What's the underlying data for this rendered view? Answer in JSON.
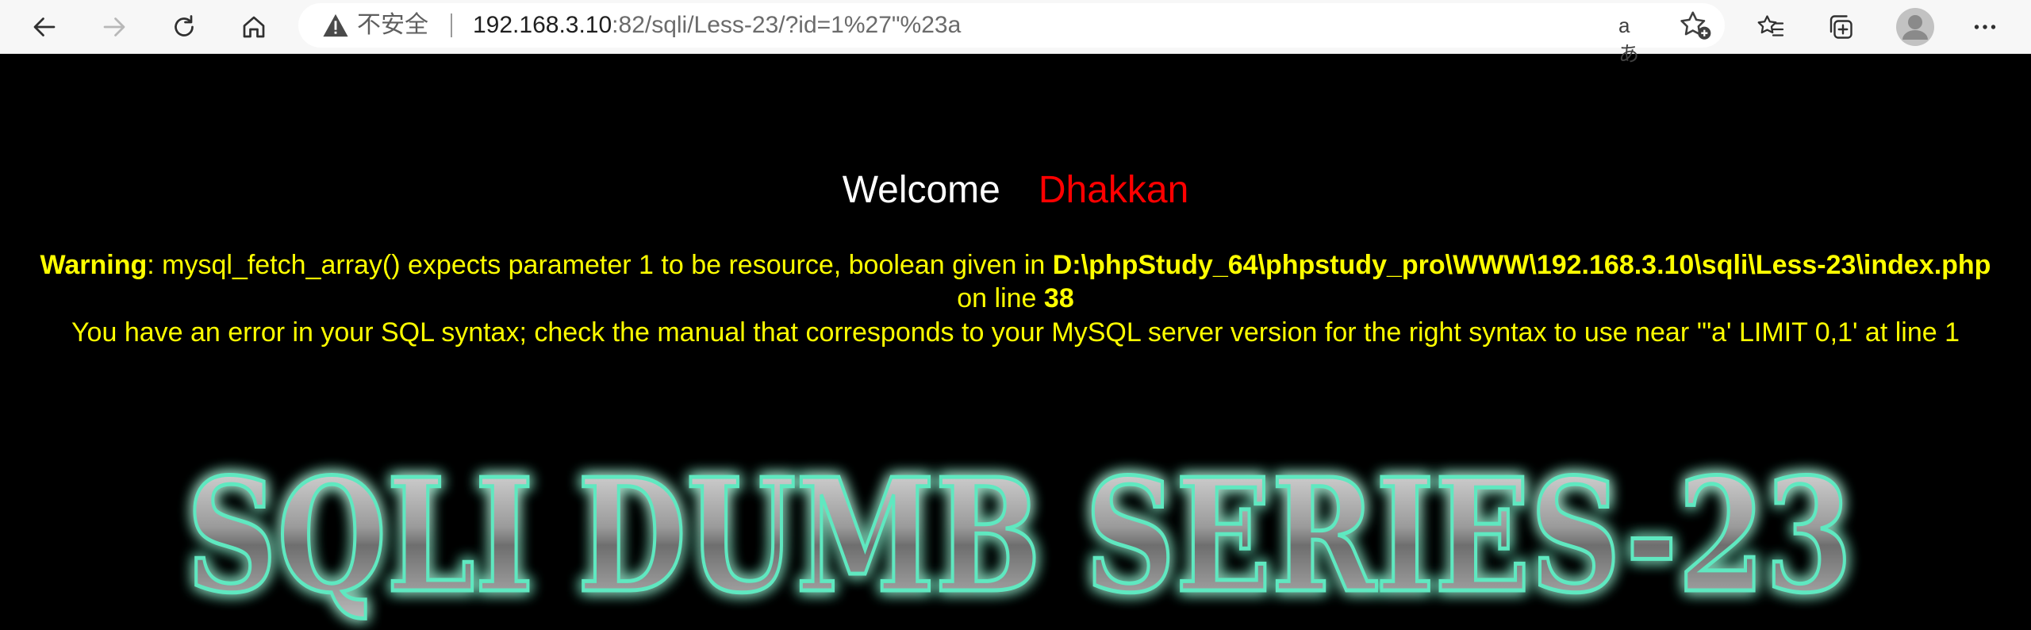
{
  "browser": {
    "security_label": "不安全",
    "url_host": "192.168.3.10",
    "url_rest": ":82/sqli/Less-23/?id=1%27\"%23a",
    "read_aloud_glyph": "aあ",
    "icons": [
      "back-arrow-icon",
      "forward-arrow-icon",
      "refresh-icon",
      "home-icon",
      "warning-triangle-icon",
      "read-aloud-icon",
      "add-favorite-icon",
      "favorites-icon",
      "collections-icon",
      "profile-avatar-icon",
      "more-menu-icon"
    ]
  },
  "page": {
    "welcome": "Welcome",
    "username": "Dhakkan",
    "warning_label": "Warning",
    "warning_text": ": mysql_fetch_array() expects parameter 1 to be resource, boolean given in ",
    "warning_path": "D:\\phpStudy_64\\phpstudy_pro\\WWW\\192.168.3.10\\sqli\\Less-23\\index.php",
    "on_line_text": "on line ",
    "line_number": "38",
    "sql_error": "You have an error in your SQL syntax; check the manual that corresponds to your MySQL server version for the right syntax to use near '\"a' LIMIT 0,1' at line 1",
    "banner_text": "SQLI DUMB SERIES-23"
  },
  "colors": {
    "page_bg": "#000000",
    "welcome": "#ffffff",
    "username": "#ff0000",
    "warning": "#ffff00",
    "banner_glow": "#40e0b0"
  }
}
